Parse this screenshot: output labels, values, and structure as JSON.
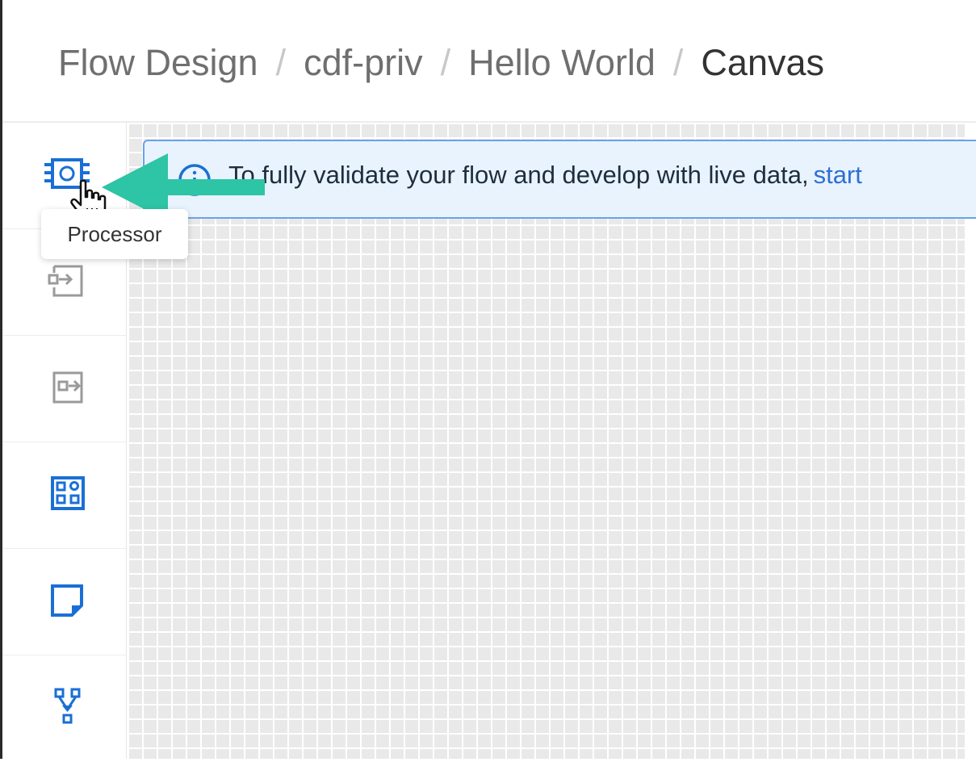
{
  "breadcrumb": {
    "items": [
      "Flow Design",
      "cdf-priv",
      "Hello World",
      "Canvas"
    ],
    "separator": "/"
  },
  "toolbar": {
    "items": [
      {
        "icon": "processor-icon",
        "color": "#1a6fd6"
      },
      {
        "icon": "input-port-icon",
        "color": "#9a9a9a"
      },
      {
        "icon": "output-port-icon",
        "color": "#9a9a9a"
      },
      {
        "icon": "process-group-icon",
        "color": "#1a6fd6"
      },
      {
        "icon": "label-icon",
        "color": "#1a6fd6"
      },
      {
        "icon": "funnel-icon",
        "color": "#1a6fd6"
      }
    ],
    "tooltip": "Processor"
  },
  "banner": {
    "icon": "info-icon",
    "text": "To fully validate your flow and develop with live data,",
    "link": "start"
  },
  "annotation": {
    "arrow_color": "#2ec4a6"
  },
  "colors": {
    "accent": "#1a6fd6",
    "banner_bg": "#e8f3fd",
    "banner_border": "#6aa3e6",
    "canvas_bg": "#e9e9ea"
  }
}
